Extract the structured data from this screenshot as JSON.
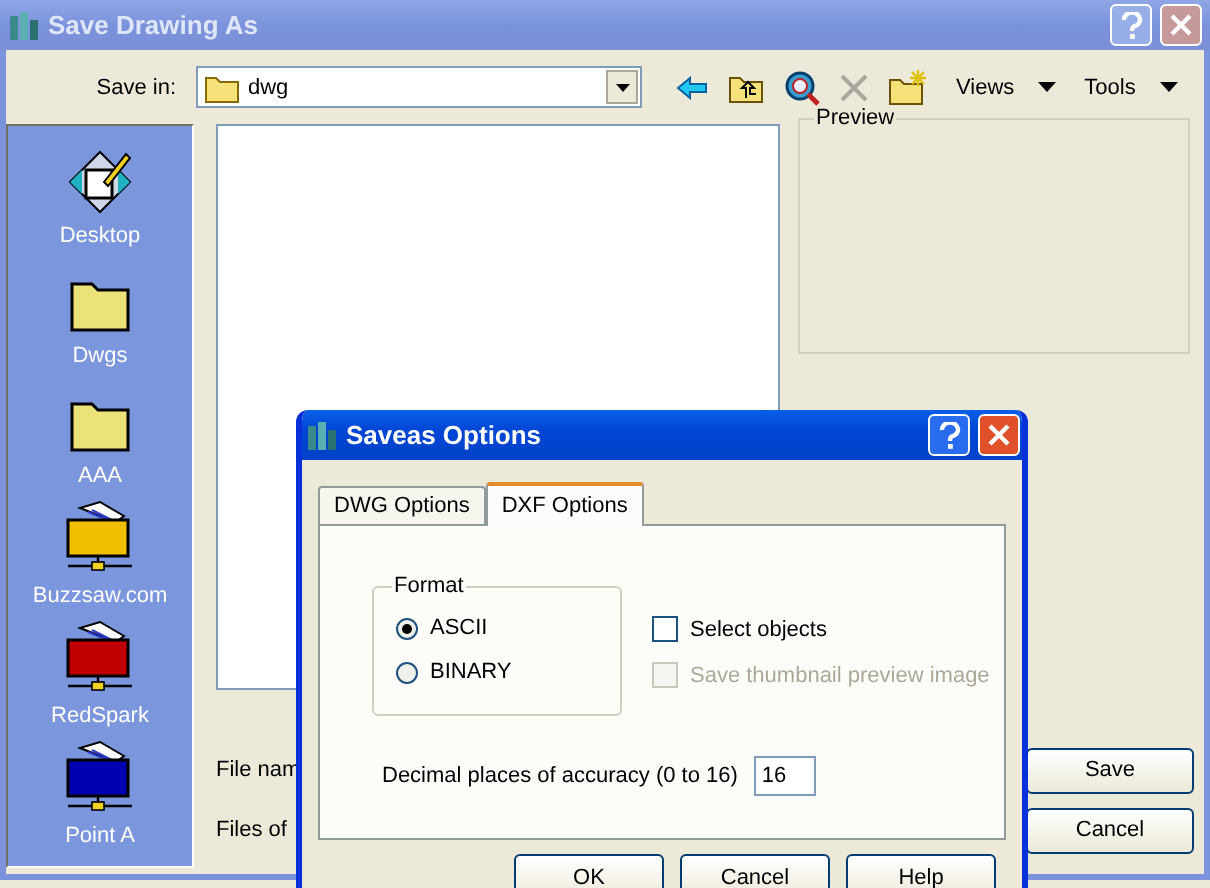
{
  "main_window": {
    "title": "Save Drawing As",
    "active": false
  },
  "save_in": {
    "label": "Save in:",
    "value": "dwg"
  },
  "toolbar": [
    {
      "kind": "back",
      "disabled": false
    },
    {
      "kind": "up",
      "disabled": false
    },
    {
      "kind": "search",
      "disabled": false
    },
    {
      "kind": "delete",
      "disabled": true
    },
    {
      "kind": "newfolder",
      "disabled": false
    }
  ],
  "menus": [
    {
      "label": "Views"
    },
    {
      "label": "Tools"
    }
  ],
  "places": [
    {
      "label": "Desktop",
      "kind": "desktop"
    },
    {
      "label": "Dwgs",
      "kind": "folder"
    },
    {
      "label": "AAA",
      "kind": "folder"
    },
    {
      "label": "Buzzsaw.com",
      "kind": "network",
      "color": "#f0c000"
    },
    {
      "label": "RedSpark",
      "kind": "network",
      "color": "#c00000"
    },
    {
      "label": "Point A",
      "kind": "network",
      "color": "#0000b0"
    }
  ],
  "preview": {
    "label": "Preview"
  },
  "file_name": {
    "label": "File nam"
  },
  "file_type": {
    "label": "Files of"
  },
  "buttons": [
    "Save",
    "Cancel"
  ],
  "options_dialog": {
    "title": "Saveas Options",
    "active": true,
    "tabs": [
      {
        "label": "DWG Options",
        "selected": false
      },
      {
        "label": "DXF Options",
        "selected": true
      }
    ],
    "format": {
      "label": "Format",
      "options": [
        {
          "label": "ASCII",
          "selected": true
        },
        {
          "label": "BINARY",
          "selected": false
        }
      ]
    },
    "checkboxes": [
      {
        "label": "Select objects",
        "checked": false,
        "disabled": false
      },
      {
        "label": "Save thumbnail preview image",
        "checked": false,
        "disabled": true
      }
    ],
    "accuracy": {
      "label": "Decimal places of accuracy (0 to 16)",
      "value": "16"
    },
    "buttons": [
      "OK",
      "Cancel",
      "Help"
    ]
  }
}
